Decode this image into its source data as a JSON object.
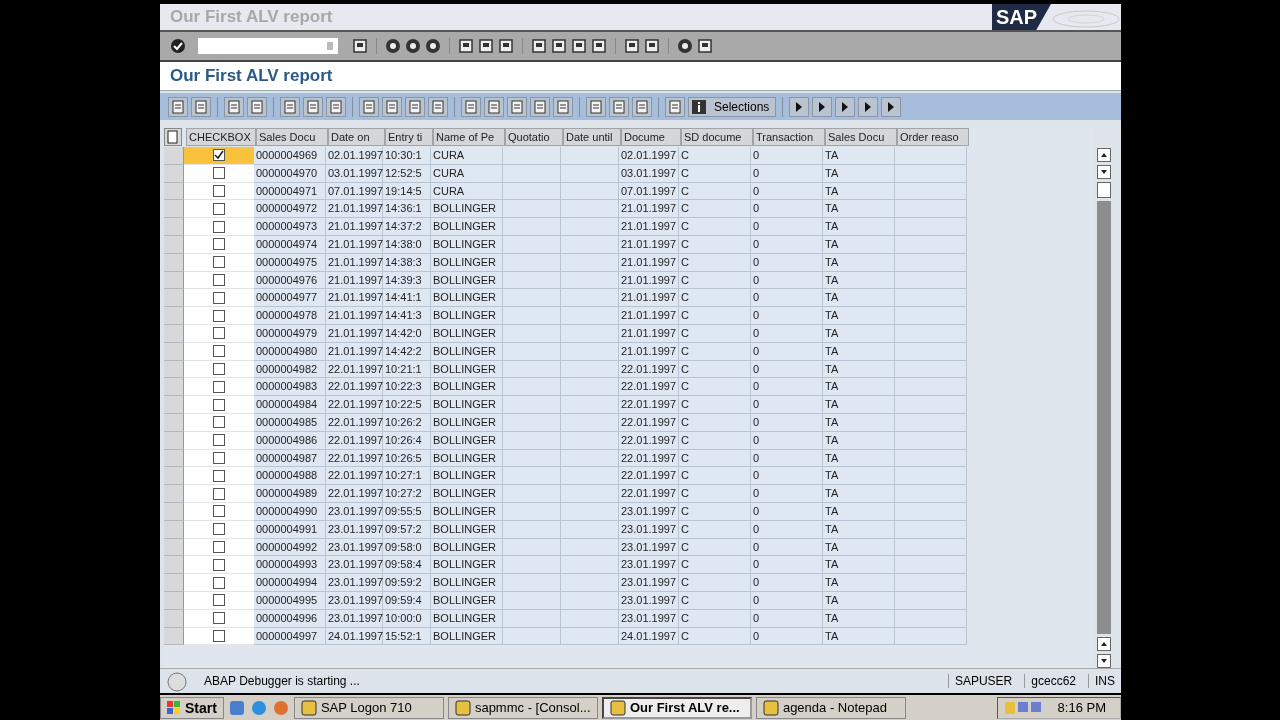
{
  "window": {
    "title": "Our First ALV report"
  },
  "logo": "SAP",
  "screen_title": "Our First ALV report",
  "alv_toolbar": {
    "selections_button": "Selections"
  },
  "table": {
    "checkbox_header": "CHECKBOX",
    "columns": [
      {
        "label": "Sales Docu"
      },
      {
        "label": "Date on"
      },
      {
        "label": "Entry ti"
      },
      {
        "label": "Name of Pe"
      },
      {
        "label": "Quotatio"
      },
      {
        "label": "Date until"
      },
      {
        "label": "Docume"
      },
      {
        "label": "SD docume"
      },
      {
        "label": "Transaction"
      },
      {
        "label": "Sales Docu"
      },
      {
        "label": "Order reaso"
      }
    ],
    "rows": [
      {
        "checked": true,
        "selected": true,
        "cells": [
          "0000004969",
          "02.01.1997",
          "10:30:1",
          "CURA",
          null,
          null,
          "02.01.1997",
          "C",
          "0",
          "TA",
          null
        ]
      },
      {
        "checked": false,
        "selected": false,
        "cells": [
          "0000004970",
          "03.01.1997",
          "12:52:5",
          "CURA",
          null,
          null,
          "03.01.1997",
          "C",
          "0",
          "TA",
          null
        ]
      },
      {
        "checked": false,
        "selected": false,
        "cells": [
          "0000004971",
          "07.01.1997",
          "19:14:5",
          "CURA",
          null,
          null,
          "07.01.1997",
          "C",
          "0",
          "TA",
          null
        ]
      },
      {
        "checked": false,
        "selected": false,
        "cells": [
          "0000004972",
          "21.01.1997",
          "14:36:1",
          "BOLLINGER",
          null,
          null,
          "21.01.1997",
          "C",
          "0",
          "TA",
          null
        ]
      },
      {
        "checked": false,
        "selected": false,
        "cells": [
          "0000004973",
          "21.01.1997",
          "14:37:2",
          "BOLLINGER",
          null,
          null,
          "21.01.1997",
          "C",
          "0",
          "TA",
          null
        ]
      },
      {
        "checked": false,
        "selected": false,
        "cells": [
          "0000004974",
          "21.01.1997",
          "14:38:0",
          "BOLLINGER",
          null,
          null,
          "21.01.1997",
          "C",
          "0",
          "TA",
          null
        ]
      },
      {
        "checked": false,
        "selected": false,
        "cells": [
          "0000004975",
          "21.01.1997",
          "14:38:3",
          "BOLLINGER",
          null,
          null,
          "21.01.1997",
          "C",
          "0",
          "TA",
          null
        ]
      },
      {
        "checked": false,
        "selected": false,
        "cells": [
          "0000004976",
          "21.01.1997",
          "14:39:3",
          "BOLLINGER",
          null,
          null,
          "21.01.1997",
          "C",
          "0",
          "TA",
          null
        ]
      },
      {
        "checked": false,
        "selected": false,
        "cells": [
          "0000004977",
          "21.01.1997",
          "14:41:1",
          "BOLLINGER",
          null,
          null,
          "21.01.1997",
          "C",
          "0",
          "TA",
          null
        ]
      },
      {
        "checked": false,
        "selected": false,
        "cells": [
          "0000004978",
          "21.01.1997",
          "14:41:3",
          "BOLLINGER",
          null,
          null,
          "21.01.1997",
          "C",
          "0",
          "TA",
          null
        ]
      },
      {
        "checked": false,
        "selected": false,
        "cells": [
          "0000004979",
          "21.01.1997",
          "14:42:0",
          "BOLLINGER",
          null,
          null,
          "21.01.1997",
          "C",
          "0",
          "TA",
          null
        ]
      },
      {
        "checked": false,
        "selected": false,
        "cells": [
          "0000004980",
          "21.01.1997",
          "14:42:2",
          "BOLLINGER",
          null,
          null,
          "21.01.1997",
          "C",
          "0",
          "TA",
          null
        ]
      },
      {
        "checked": false,
        "selected": false,
        "cells": [
          "0000004982",
          "22.01.1997",
          "10:21:1",
          "BOLLINGER",
          null,
          null,
          "22.01.1997",
          "C",
          "0",
          "TA",
          null
        ]
      },
      {
        "checked": false,
        "selected": false,
        "cells": [
          "0000004983",
          "22.01.1997",
          "10:22:3",
          "BOLLINGER",
          null,
          null,
          "22.01.1997",
          "C",
          "0",
          "TA",
          null
        ]
      },
      {
        "checked": false,
        "selected": false,
        "cells": [
          "0000004984",
          "22.01.1997",
          "10:22:5",
          "BOLLINGER",
          null,
          null,
          "22.01.1997",
          "C",
          "0",
          "TA",
          null
        ]
      },
      {
        "checked": false,
        "selected": false,
        "cells": [
          "0000004985",
          "22.01.1997",
          "10:26:2",
          "BOLLINGER",
          null,
          null,
          "22.01.1997",
          "C",
          "0",
          "TA",
          null
        ]
      },
      {
        "checked": false,
        "selected": false,
        "cells": [
          "0000004986",
          "22.01.1997",
          "10:26:4",
          "BOLLINGER",
          null,
          null,
          "22.01.1997",
          "C",
          "0",
          "TA",
          null
        ]
      },
      {
        "checked": false,
        "selected": false,
        "cells": [
          "0000004987",
          "22.01.1997",
          "10:26:5",
          "BOLLINGER",
          null,
          null,
          "22.01.1997",
          "C",
          "0",
          "TA",
          null
        ]
      },
      {
        "checked": false,
        "selected": false,
        "cells": [
          "0000004988",
          "22.01.1997",
          "10:27:1",
          "BOLLINGER",
          null,
          null,
          "22.01.1997",
          "C",
          "0",
          "TA",
          null
        ]
      },
      {
        "checked": false,
        "selected": false,
        "cells": [
          "0000004989",
          "22.01.1997",
          "10:27:2",
          "BOLLINGER",
          null,
          null,
          "22.01.1997",
          "C",
          "0",
          "TA",
          null
        ]
      },
      {
        "checked": false,
        "selected": false,
        "cells": [
          "0000004990",
          "23.01.1997",
          "09:55:5",
          "BOLLINGER",
          null,
          null,
          "23.01.1997",
          "C",
          "0",
          "TA",
          null
        ]
      },
      {
        "checked": false,
        "selected": false,
        "cells": [
          "0000004991",
          "23.01.1997",
          "09:57:2",
          "BOLLINGER",
          null,
          null,
          "23.01.1997",
          "C",
          "0",
          "TA",
          null
        ]
      },
      {
        "checked": false,
        "selected": false,
        "cells": [
          "0000004992",
          "23.01.1997",
          "09:58:0",
          "BOLLINGER",
          null,
          null,
          "23.01.1997",
          "C",
          "0",
          "TA",
          null
        ]
      },
      {
        "checked": false,
        "selected": false,
        "cells": [
          "0000004993",
          "23.01.1997",
          "09:58:4",
          "BOLLINGER",
          null,
          null,
          "23.01.1997",
          "C",
          "0",
          "TA",
          null
        ]
      },
      {
        "checked": false,
        "selected": false,
        "cells": [
          "0000004994",
          "23.01.1997",
          "09:59:2",
          "BOLLINGER",
          null,
          null,
          "23.01.1997",
          "C",
          "0",
          "TA",
          null
        ]
      },
      {
        "checked": false,
        "selected": false,
        "cells": [
          "0000004995",
          "23.01.1997",
          "09:59:4",
          "BOLLINGER",
          null,
          null,
          "23.01.1997",
          "C",
          "0",
          "TA",
          null
        ]
      },
      {
        "checked": false,
        "selected": false,
        "cells": [
          "0000004996",
          "23.01.1997",
          "10:00:0",
          "BOLLINGER",
          null,
          null,
          "23.01.1997",
          "C",
          "0",
          "TA",
          null
        ]
      },
      {
        "checked": false,
        "selected": false,
        "cells": [
          "0000004997",
          "24.01.1997",
          "15:52:1",
          "BOLLINGER",
          null,
          null,
          "24.01.1997",
          "C",
          "0",
          "TA",
          null
        ]
      }
    ]
  },
  "status_bar": {
    "message": "ABAP Debugger is starting ...",
    "user": "SAPUSER",
    "server": "gcecc62",
    "mode": "INS"
  },
  "taskbar": {
    "start": "Start",
    "tasks": [
      {
        "label": "SAP Logon 710",
        "selected": false
      },
      {
        "label": "sapmmc - [Consol...",
        "selected": false
      },
      {
        "label": "Our First ALV re...",
        "selected": true
      },
      {
        "label": "agenda - Notepad",
        "selected": false
      }
    ],
    "clock": "8:16 PM"
  }
}
